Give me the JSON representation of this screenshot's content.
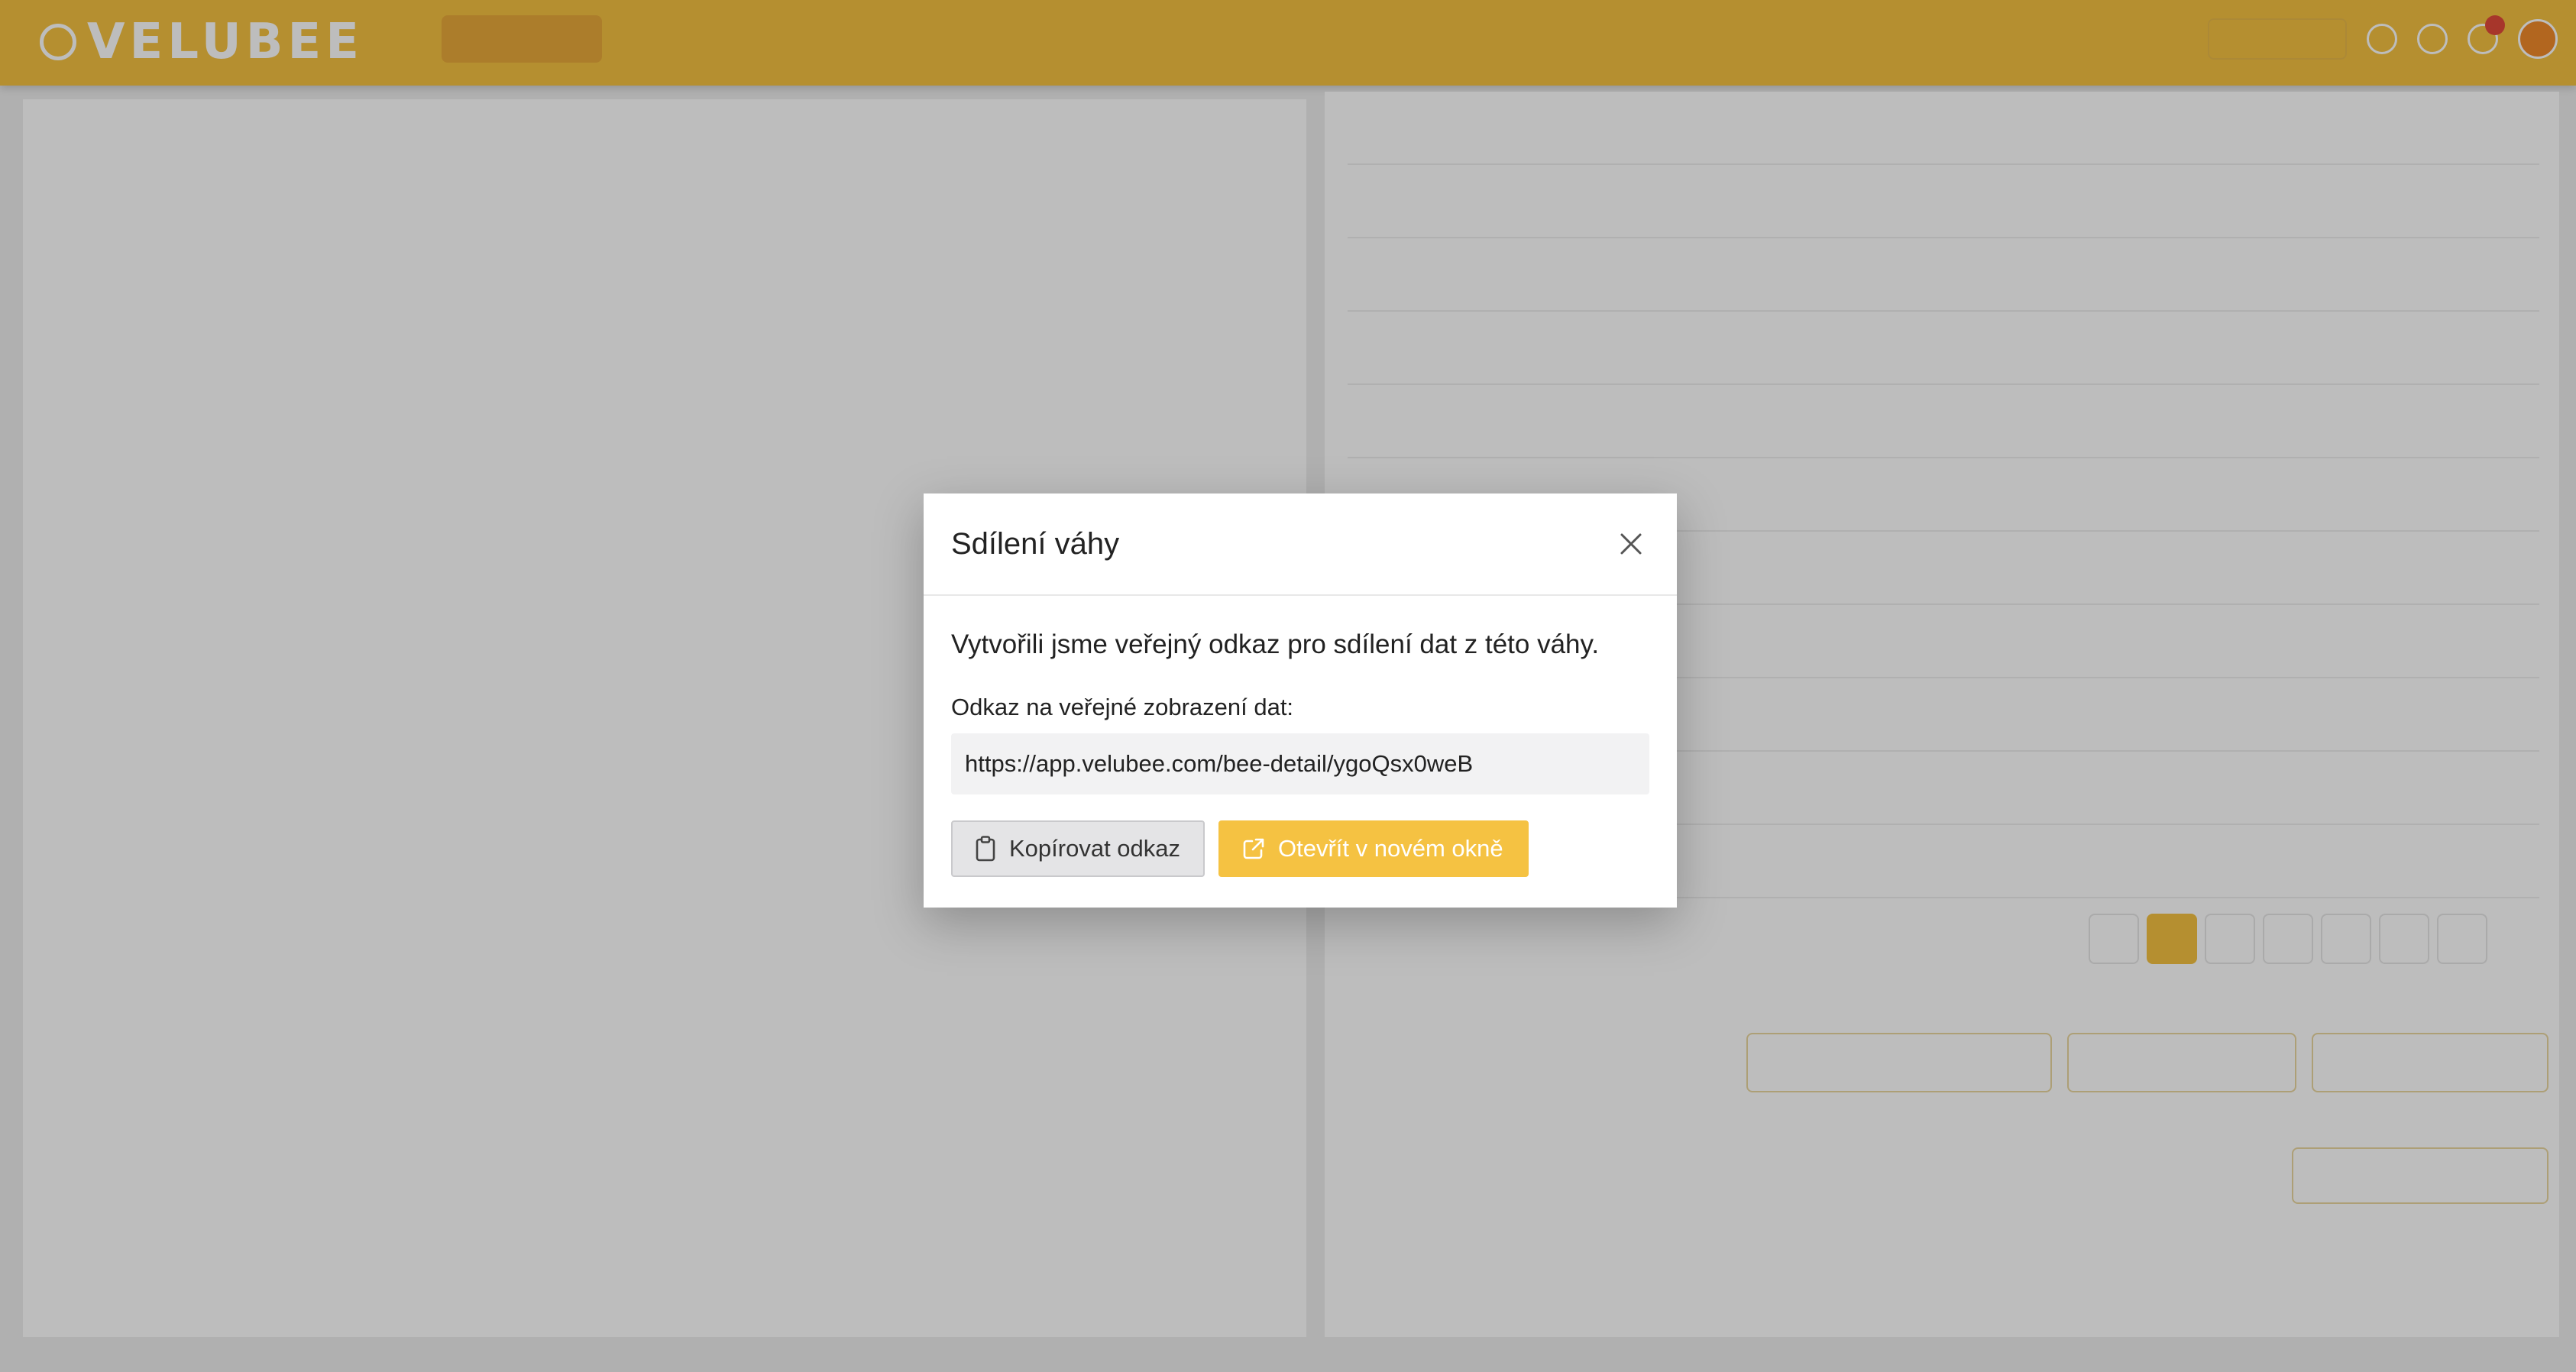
{
  "modal": {
    "title": "Sdílení váhy",
    "lead": "Vytvořili jsme veřejný odkaz pro sdílení dat z této váhy.",
    "link_label": "Odkaz na veřejné zobrazení dat:",
    "link_value": "https://app.velubee.com/bee-detail/ygoQsx0weB",
    "copy_button": "Kopírovat odkaz",
    "open_button": "Otevřít v novém okně"
  },
  "background": {
    "logo": "VELUBEE",
    "nav": [],
    "colors": {
      "accent": "#f5c242",
      "accent_dark": "#e9a93a",
      "button_copy_bg": "#e4e4e6"
    },
    "icons": {
      "close": "close-icon",
      "copy": "clipboard-icon",
      "open": "external-link-icon"
    }
  }
}
